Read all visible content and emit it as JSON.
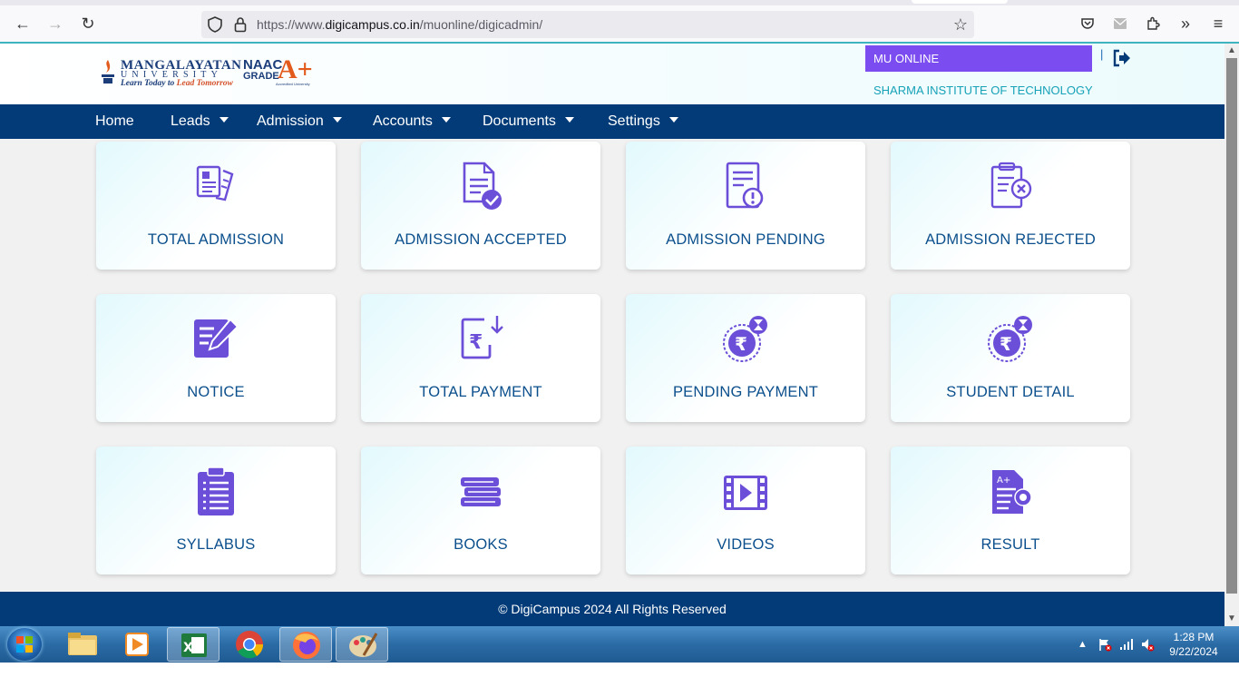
{
  "browser": {
    "url_prefix": "https://www.",
    "url_domain": "digicampus.co.in",
    "url_path": "/muonline/digicadmin/"
  },
  "header": {
    "logo": {
      "name_line1": "MANGALAYATAN",
      "name_line2": "UNIVERSITY",
      "tagline_part1": "Learn Today to ",
      "tagline_part2": "Lead Tomorrow",
      "naac": "NAAC",
      "grade": "GRADE",
      "grade_value": "A+",
      "accredited": "Accredited University"
    },
    "badge": "MU ONLINE",
    "separator": "|",
    "institute": "SHARMA INSTITUTE OF TECHNOLOGY"
  },
  "nav": {
    "items": [
      {
        "label": "Home",
        "dropdown": false
      },
      {
        "label": "Leads",
        "dropdown": true
      },
      {
        "label": "Admission",
        "dropdown": true
      },
      {
        "label": "Accounts",
        "dropdown": true
      },
      {
        "label": "Documents",
        "dropdown": true
      },
      {
        "label": "Settings",
        "dropdown": true
      }
    ]
  },
  "cards": [
    {
      "label": "TOTAL ADMISSION",
      "icon": "documents-stack-icon"
    },
    {
      "label": "ADMISSION ACCEPTED",
      "icon": "document-check-icon"
    },
    {
      "label": "ADMISSION PENDING",
      "icon": "document-alert-icon"
    },
    {
      "label": "ADMISSION REJECTED",
      "icon": "clipboard-x-icon"
    },
    {
      "label": "NOTICE",
      "icon": "edit-note-icon"
    },
    {
      "label": "TOTAL PAYMENT",
      "icon": "rupee-receipt-icon"
    },
    {
      "label": "PENDING PAYMENT",
      "icon": "rupee-hourglass-icon"
    },
    {
      "label": "STUDENT DETAIL",
      "icon": "rupee-hourglass-icon"
    },
    {
      "label": "SYLLABUS",
      "icon": "clipboard-list-icon"
    },
    {
      "label": "BOOKS",
      "icon": "books-icon"
    },
    {
      "label": "VIDEOS",
      "icon": "video-film-icon"
    },
    {
      "label": "RESULT",
      "icon": "result-certificate-icon"
    }
  ],
  "footer": {
    "text": "© DigiCampus 2024 All Rights Reserved"
  },
  "taskbar": {
    "time": "1:28 PM",
    "date": "9/22/2024"
  },
  "colors": {
    "nav_bg": "#023b78",
    "icon_purple": "#6c4fd8",
    "badge_purple": "#7b4cf0",
    "card_label": "#0b4f8c",
    "institute": "#17a2b8"
  }
}
